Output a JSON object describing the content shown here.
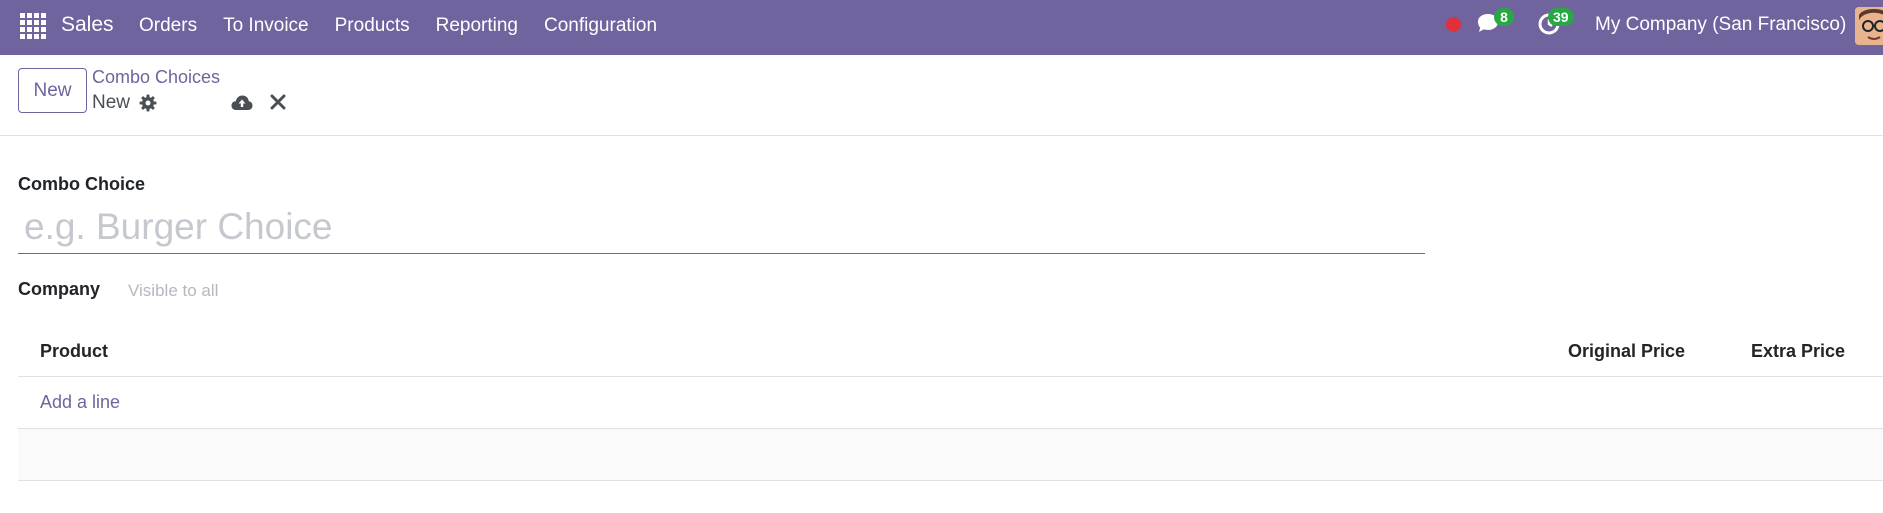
{
  "navbar": {
    "brand": "Sales",
    "menu": [
      "Orders",
      "To Invoice",
      "Products",
      "Reporting",
      "Configuration"
    ],
    "chat_count": "8",
    "activity_count": "39",
    "company": "My Company (San Francisco)",
    "accent_color": "#71639e"
  },
  "control_panel": {
    "new_button": "New",
    "breadcrumb_parent": "Combo Choices",
    "record_name": "New"
  },
  "form": {
    "name_label": "Combo Choice",
    "name_placeholder": "e.g. Burger Choice",
    "name_value": "",
    "company_label": "Company",
    "company_placeholder": "Visible to all",
    "company_value": ""
  },
  "lines": {
    "columns": [
      "Product",
      "Original Price",
      "Extra Price"
    ],
    "add_line": "Add a line",
    "rows": []
  }
}
